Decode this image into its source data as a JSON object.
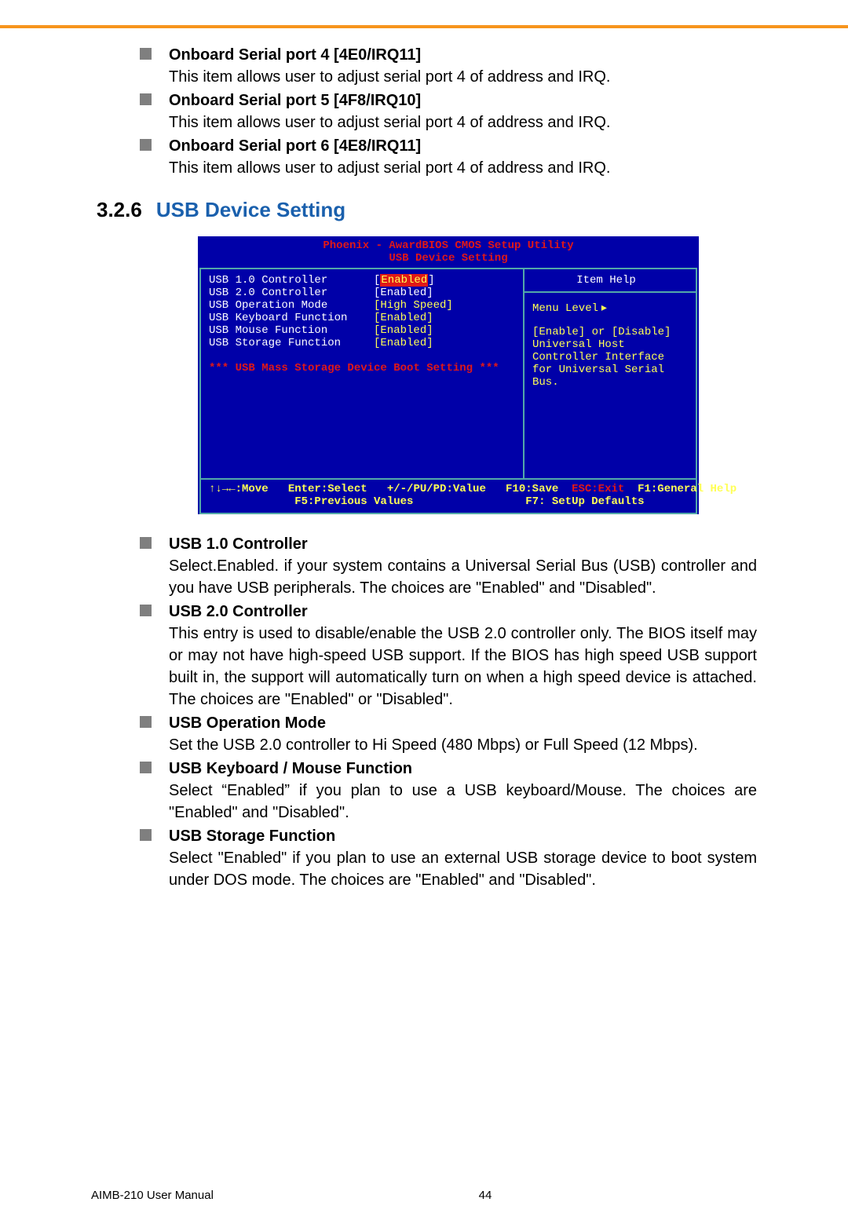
{
  "top_items": [
    {
      "heading": "Onboard Serial port 4 [4E0/IRQ11]",
      "body": "This item allows user to adjust serial port 4 of address and IRQ."
    },
    {
      "heading": "Onboard Serial port 5 [4F8/IRQ10]",
      "body": "This item allows user to adjust serial port 4 of address and IRQ."
    },
    {
      "heading": "Onboard Serial port 6 [4E8/IRQ11]",
      "body": "This item allows user to adjust serial port 4 of address and IRQ."
    }
  ],
  "section": {
    "number": "3.2.6",
    "title": "USB Device Setting"
  },
  "bios": {
    "title1": "Phoenix - AwardBIOS CMOS Setup Utility",
    "title2": "USB Device Setting",
    "rows": [
      {
        "k": "USB 1.0 Controller",
        "v": "Enabled",
        "sel": true
      },
      {
        "k": "USB 2.0 Controller",
        "v": "Enabled",
        "sel": false
      },
      {
        "k": "USB Operation Mode",
        "v": "High Speed",
        "sel": false
      },
      {
        "k": "USB Keyboard Function",
        "v": "Enabled",
        "sel": false
      },
      {
        "k": "USB Mouse Function",
        "v": "Enabled",
        "sel": false
      },
      {
        "k": "USB Storage Function",
        "v": "Enabled",
        "sel": false
      }
    ],
    "boot_line": "*** USB Mass Storage Device Boot Setting ***",
    "help_title": "Item Help",
    "menu_level": "Menu Level",
    "help_body": "[Enable] or [Disable] Universal Host Controller Interface for Universal Serial Bus.",
    "foot1_left": "↑↓→←:Move   Enter:Select   +/-/PU/PD:Value   F10:Save  ",
    "foot1_exit": "ESC:Exit",
    "foot1_right": "  F1:General Help",
    "foot2": "             F5:Previous Values                 F7: SetUp Defaults"
  },
  "bottom_items": [
    {
      "heading": "USB 1.0 Controller",
      "body": "Select.Enabled. if your system contains a Universal Serial Bus (USB) controller and you have USB peripherals. The choices are \"Enabled\" and \"Disabled\"."
    },
    {
      "heading": "USB 2.0 Controller",
      "body": "This entry is used to disable/enable the USB 2.0 controller only. The BIOS itself may or may not have high-speed USB support. If the BIOS has high speed USB support built in, the support will automatically turn on when a high speed device is attached. The choices are \"Enabled\" or \"Disabled\"."
    },
    {
      "heading": "USB Operation Mode",
      "body": "Set the USB 2.0 controller to Hi Speed (480 Mbps) or Full Speed (12 Mbps)."
    },
    {
      "heading": "USB Keyboard / Mouse Function",
      "body": "Select “Enabled” if you plan to use a USB keyboard/Mouse. The choices are \"Enabled\" and \"Disabled\"."
    },
    {
      "heading": "USB Storage Function",
      "body": "Select \"Enabled\" if you plan to use an external USB storage device to boot system under DOS mode. The choices are \"Enabled\" and \"Disabled\"."
    }
  ],
  "footer": {
    "left": "AIMB-210 User Manual",
    "right": "44"
  }
}
